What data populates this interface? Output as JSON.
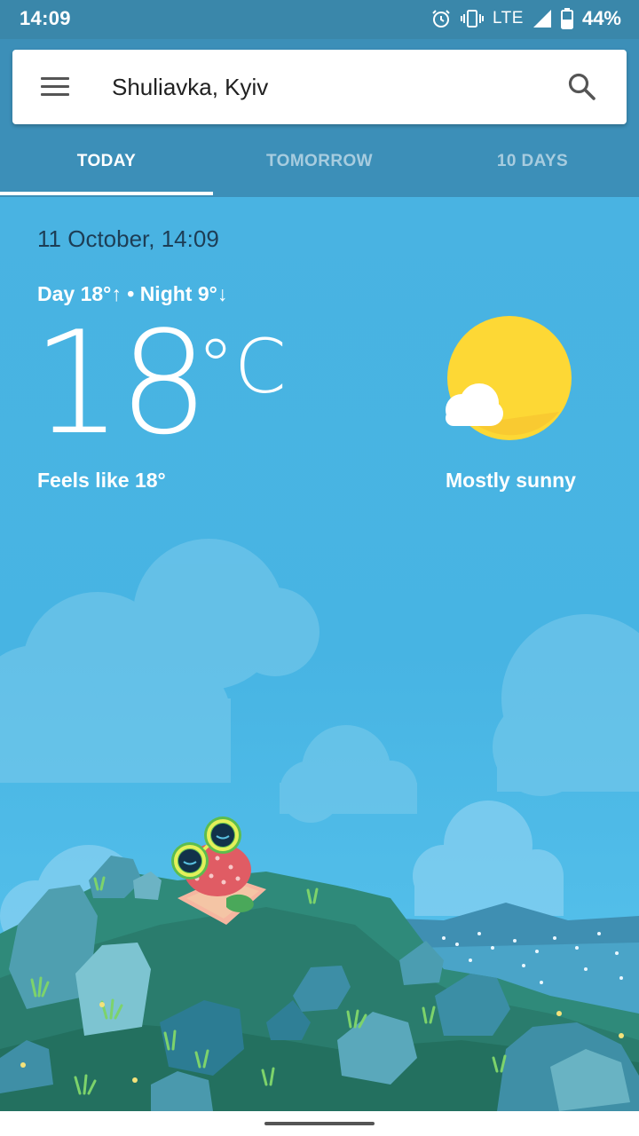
{
  "status_bar": {
    "time": "14:09",
    "network": "LTE",
    "battery": "44%",
    "icons": [
      "alarm-icon",
      "vibrate-icon",
      "signal-icon",
      "battery-icon"
    ]
  },
  "search": {
    "location": "Shuliavka, Kyiv",
    "menu_icon": "hamburger-menu-icon",
    "search_icon": "search-icon"
  },
  "tabs": [
    {
      "label": "TODAY",
      "active": true
    },
    {
      "label": "TOMORROW",
      "active": false
    },
    {
      "label": "10 DAYS",
      "active": false
    }
  ],
  "weather": {
    "date_time": "11 October, 14:09",
    "day_night": "Day 18°↑ • Night 9°↓",
    "temperature": "18",
    "unit": "°C",
    "feels_like": "Feels like 18°",
    "condition": "Mostly sunny",
    "condition_icon": "sun-with-cloud-icon"
  },
  "colors": {
    "status_bar": "#3a87aa",
    "header": "#3c8fb8",
    "sky": "#49b3e2",
    "sun": "#fdd835"
  }
}
